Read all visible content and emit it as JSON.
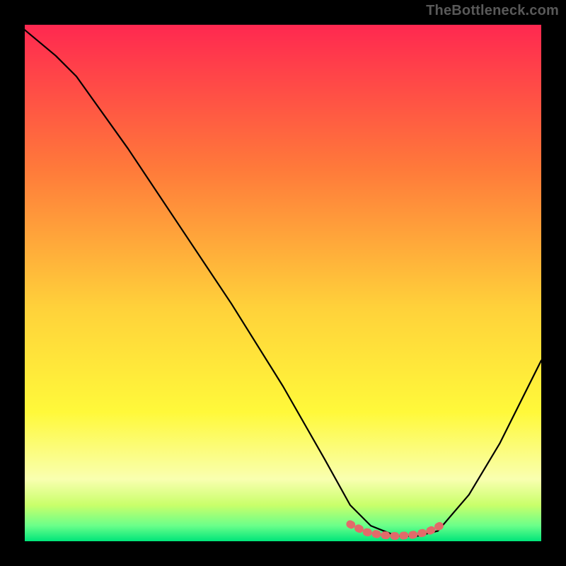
{
  "watermark": {
    "text": "TheBottleneck.com"
  },
  "colors": {
    "gradient_top": "#ff2850",
    "gradient_mid1": "#ff7a3a",
    "gradient_mid2": "#ffd23a",
    "gradient_mid3": "#fff93a",
    "gradient_bottom_yellow": "#f9ffb0",
    "gradient_green1": "#c9ff6a",
    "gradient_green2": "#6aff8a",
    "gradient_green3": "#00e57a",
    "curve_stroke": "#000000",
    "marker_fill": "#e26a6a",
    "marker_stroke": "#e26a6a",
    "background": "#000000"
  },
  "plot": {
    "inner_x": 35,
    "inner_y": 35,
    "inner_w": 730,
    "inner_h": 730
  },
  "chart_data": {
    "type": "line",
    "title": "",
    "xlabel": "",
    "ylabel": "",
    "xlim": [
      0,
      100
    ],
    "ylim": [
      0,
      100
    ],
    "grid": false,
    "legend": false,
    "series": [
      {
        "name": "curve",
        "x": [
          0,
          6,
          10,
          20,
          30,
          40,
          50,
          58,
          63,
          67,
          72,
          76,
          80,
          86,
          92,
          100
        ],
        "y": [
          99,
          94,
          90,
          76,
          61,
          46,
          30,
          16,
          7,
          3,
          1,
          1,
          2,
          9,
          19,
          35
        ]
      }
    ],
    "highlight": {
      "name": "bottom-segment",
      "x": [
        63,
        66,
        69,
        72,
        75,
        78,
        81
      ],
      "y": [
        3.3,
        1.8,
        1.2,
        1.0,
        1.2,
        1.8,
        3.3
      ]
    }
  }
}
